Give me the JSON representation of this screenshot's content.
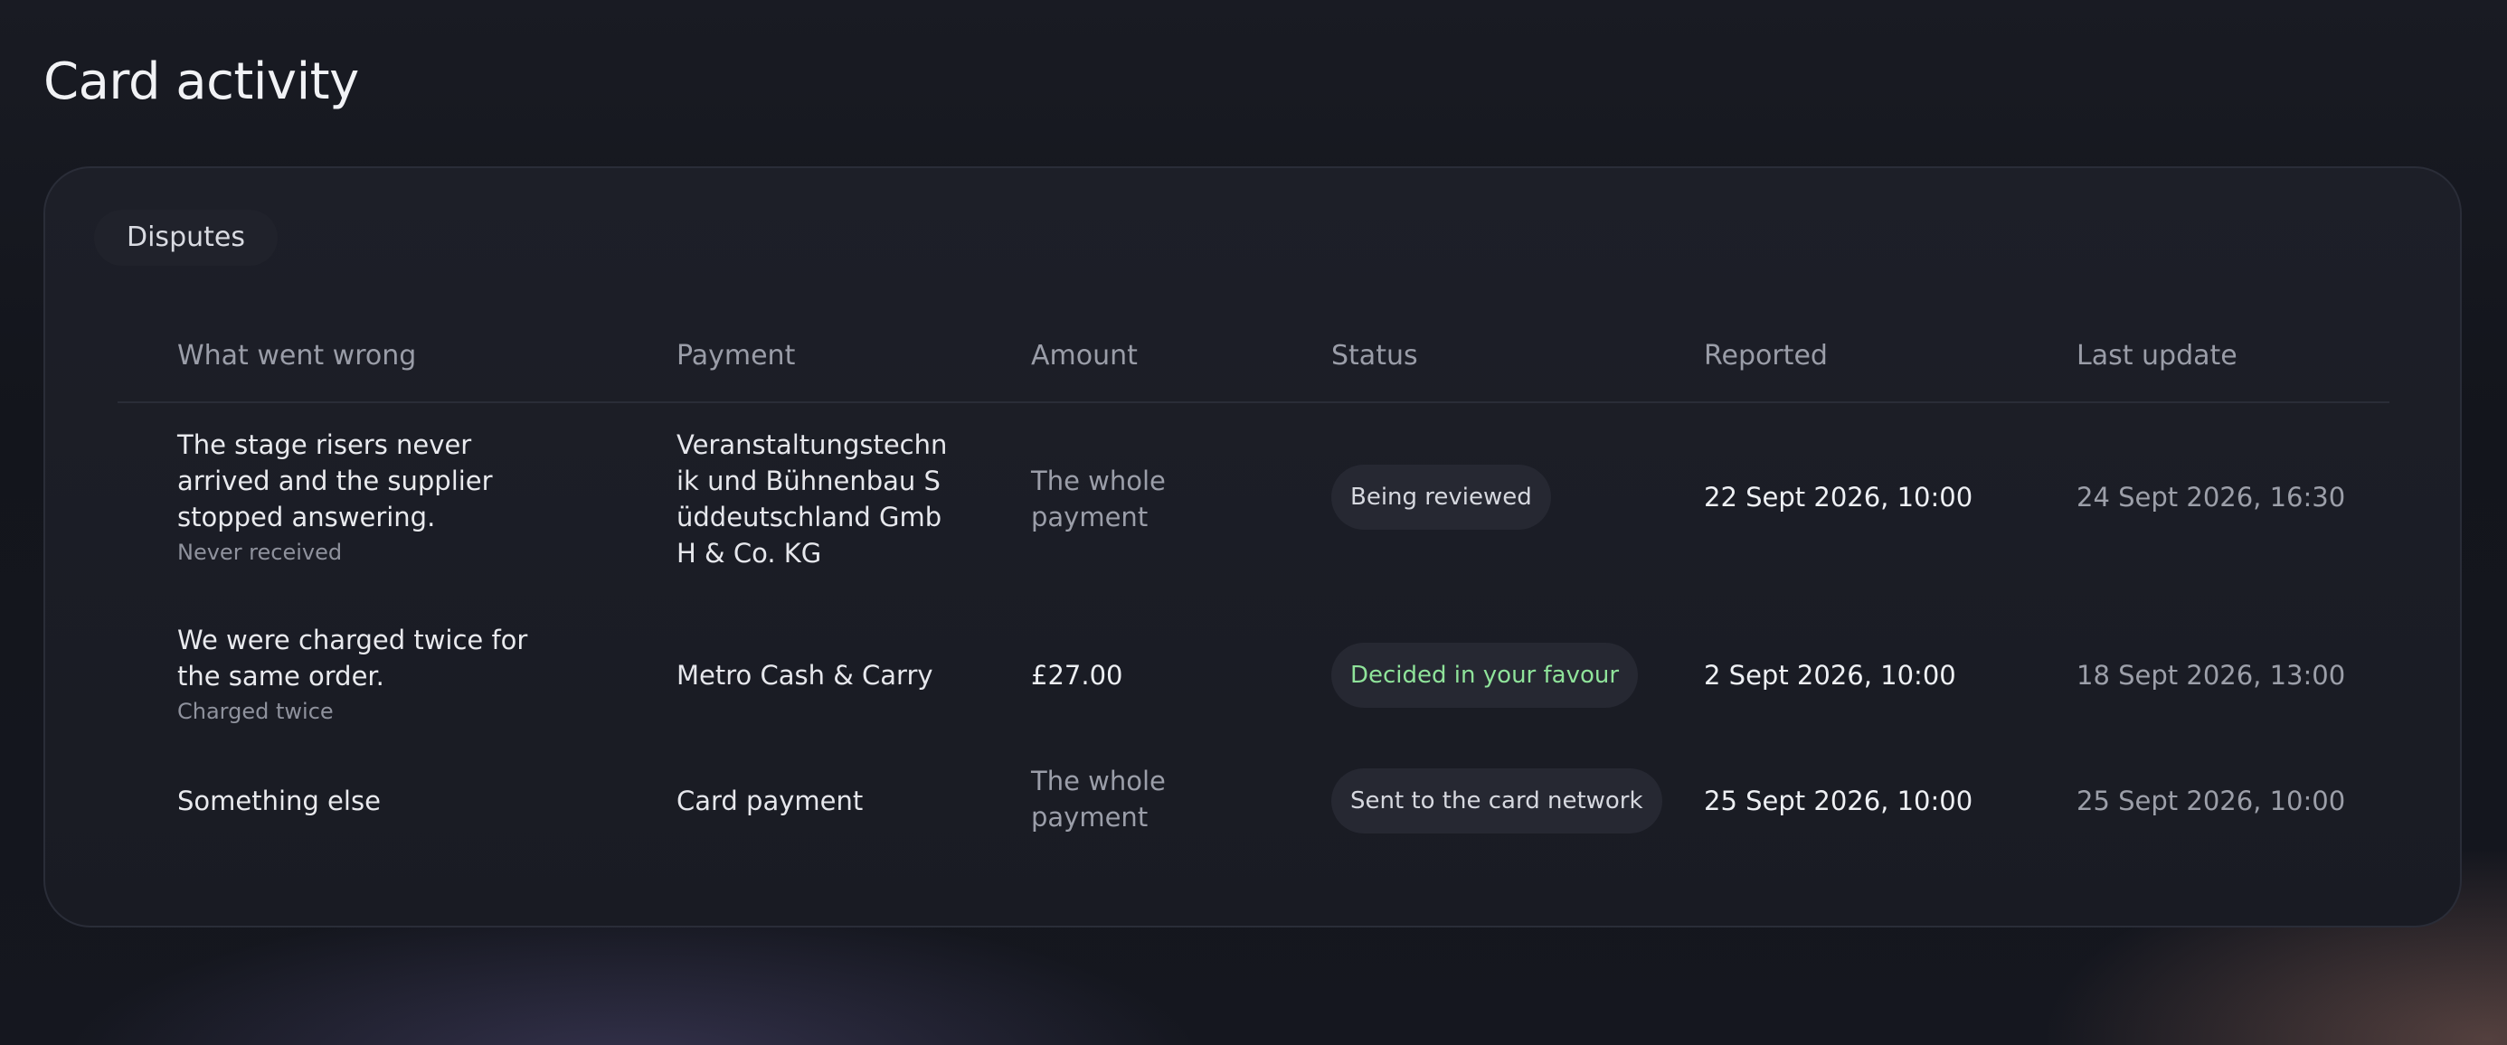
{
  "page": {
    "title": "Card activity"
  },
  "disputes": {
    "section_label": "Disputes",
    "columns": [
      "What went wrong",
      "Payment",
      "Amount",
      "Status",
      "Reported",
      "Last update"
    ],
    "rows": [
      {
        "what_went_wrong": "The stage risers never arrived and the supplier stopped answering.",
        "reason": "Never received",
        "payment": "Veranstaltungstechnik und Bühnenbau Süddeutschland GmbH & Co. KG",
        "amount": "The whole payment",
        "status": "Being reviewed",
        "status_tone": "neutral",
        "reported": "22 Sept 2026, 10:00",
        "last_update": "24 Sept 2026, 16:30"
      },
      {
        "what_went_wrong": "We were charged twice for the same order.",
        "reason": "Charged twice",
        "payment": "Metro Cash & Carry",
        "amount": "£27.00",
        "status": "Decided in your favour",
        "status_tone": "positive",
        "reported": "2 Sept 2026, 10:00",
        "last_update": "18 Sept 2026, 13:00"
      },
      {
        "what_went_wrong": "Something else",
        "reason": "",
        "payment": "Card payment",
        "amount": "The whole payment",
        "status": "Sent to the card network",
        "status_tone": "neutral",
        "reported": "25 Sept 2026, 10:00",
        "last_update": "25 Sept 2026, 10:00"
      }
    ]
  },
  "colors": {
    "background": "#15171f",
    "card": "#1b1d26",
    "badge_positive_text": "#8fe39a"
  }
}
